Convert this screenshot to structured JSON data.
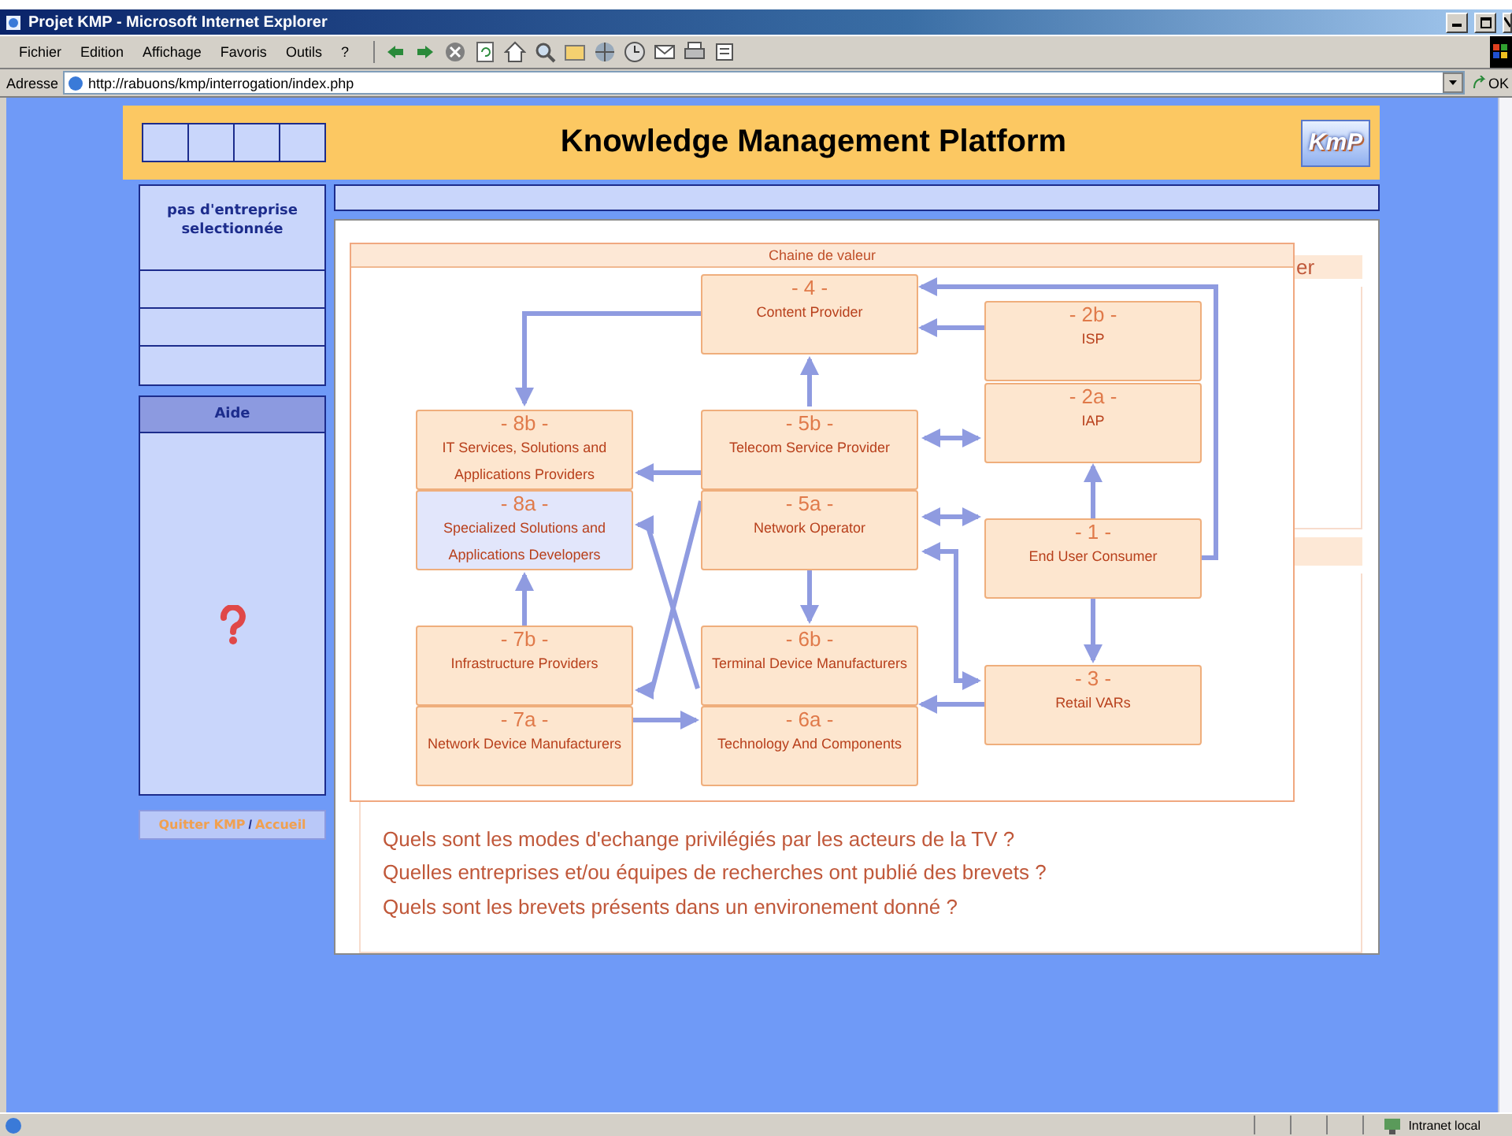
{
  "window": {
    "title": "Projet KMP - Microsoft Internet Explorer"
  },
  "menu": [
    "Fichier",
    "Edition",
    "Affichage",
    "Favoris",
    "Outils",
    "?"
  ],
  "address": {
    "label": "Adresse",
    "url": "http://rabuons/kmp/interrogation/index.php",
    "go": "OK"
  },
  "header": {
    "title": "Knowledge Management Platform",
    "logo": "KmP"
  },
  "sidebar": {
    "company": "pas d'entreprise selectionnée",
    "help_title": "Aide",
    "links": [
      "Quitter KMP",
      "Accueil"
    ],
    "separator": "/"
  },
  "content": {
    "section_title": "er",
    "questions": [
      "Quels sont les modes d'echange privilégiés par les acteurs de la TV ?",
      "Quelles entreprises et/ou équipes de recherches ont publié des brevets ?",
      "Quels sont les brevets présents dans un environement donné ?"
    ]
  },
  "diagram": {
    "title": "Chaine de valeur",
    "nodes": [
      {
        "code": "- 4 -",
        "label": "Content Provider",
        "highlighted": false
      },
      {
        "code": "- 2b -",
        "label": "ISP",
        "highlighted": false
      },
      {
        "code": "- 2a -",
        "label": "IAP",
        "highlighted": false
      },
      {
        "code": "- 8b -",
        "label": "IT Services, Solutions and Applications Providers",
        "highlighted": false
      },
      {
        "code": "- 8a -",
        "label": "Specialized Solutions and Applications Developers",
        "highlighted": true
      },
      {
        "code": "- 5b -",
        "label": "Telecom Service Provider",
        "highlighted": false
      },
      {
        "code": "- 5a -",
        "label": "Network Operator",
        "highlighted": false
      },
      {
        "code": "- 1 -",
        "label": "End User Consumer",
        "highlighted": false
      },
      {
        "code": "- 7b -",
        "label": "Infrastructure Providers",
        "highlighted": false
      },
      {
        "code": "- 7a -",
        "label": "Network Device Manufacturers",
        "highlighted": false
      },
      {
        "code": "- 6b -",
        "label": "Terminal Device Manufacturers",
        "highlighted": false
      },
      {
        "code": "- 6a -",
        "label": "Technology And Components",
        "highlighted": false
      },
      {
        "code": "- 3 -",
        "label": "Retail VARs",
        "highlighted": false
      }
    ]
  },
  "status_bar": {
    "zone": "Intranet local"
  }
}
